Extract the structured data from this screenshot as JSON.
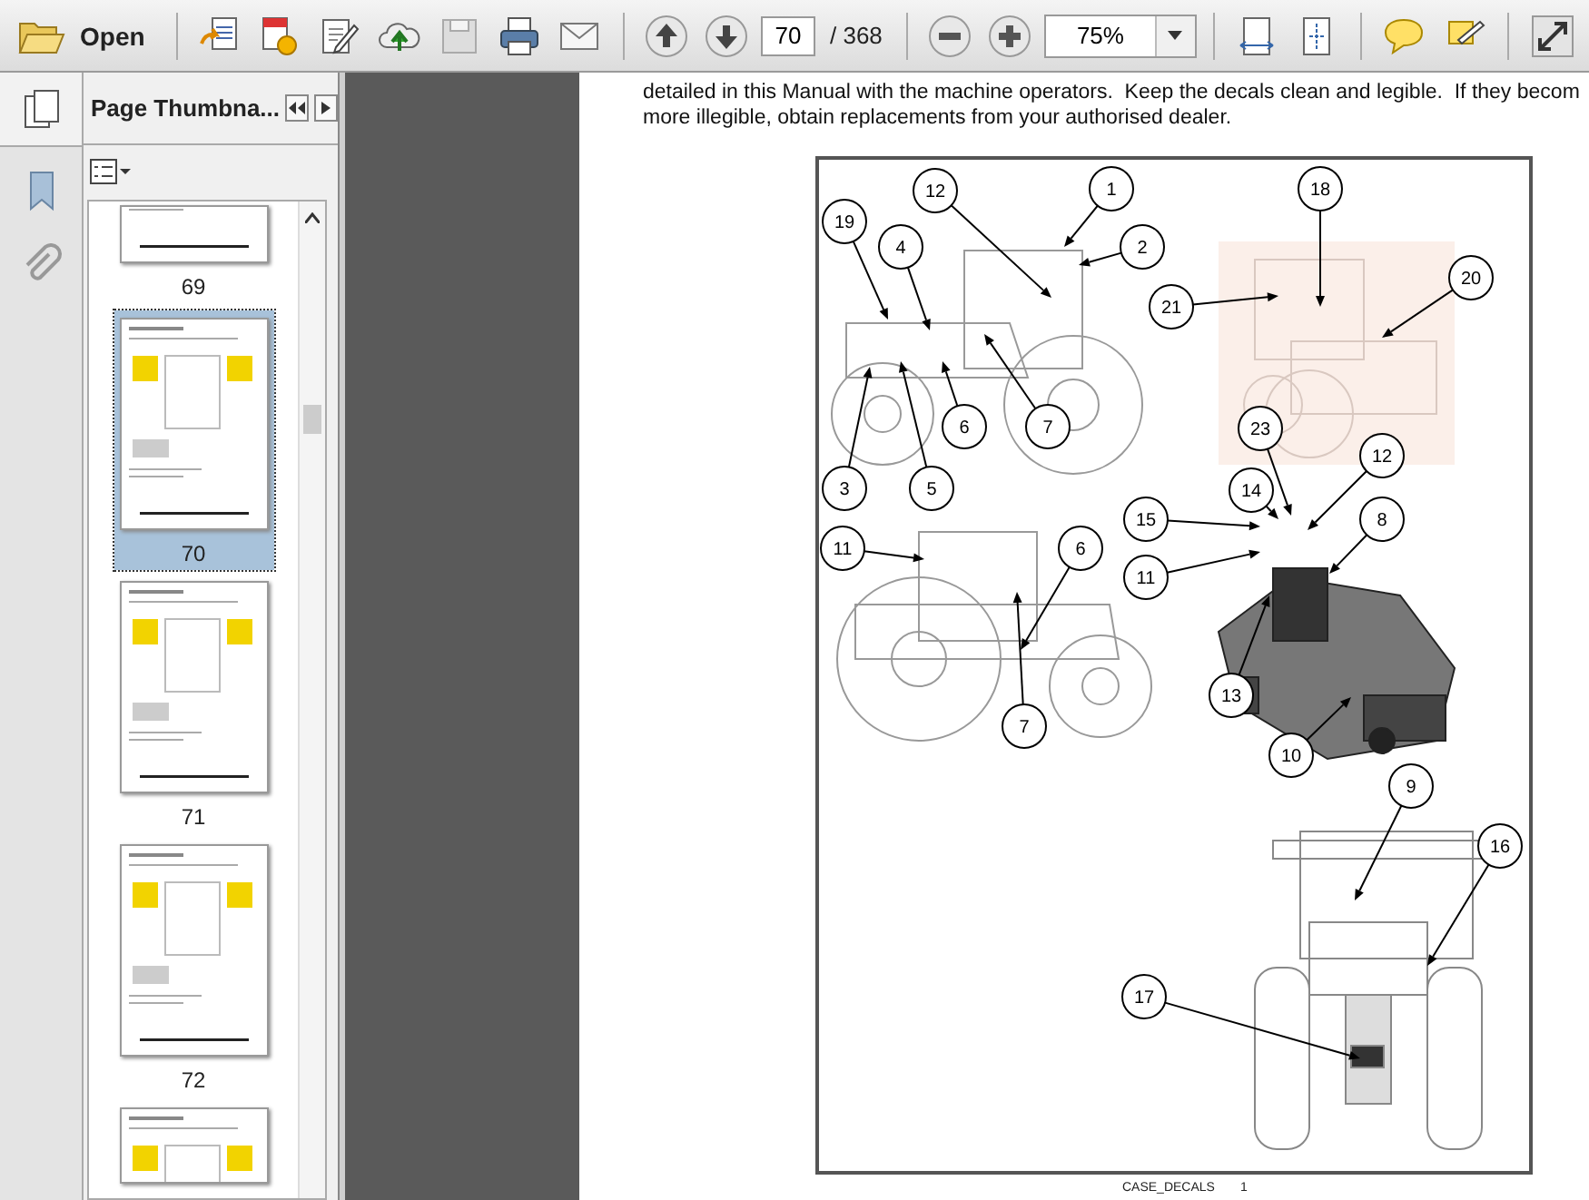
{
  "toolbar": {
    "open_label": "Open",
    "page_number": "70",
    "page_total": "/ 368",
    "zoom": "75%"
  },
  "sidebar": {
    "title": "Page Thumbna...",
    "thumbnails": [
      {
        "label": "69",
        "selected": false
      },
      {
        "label": "70",
        "selected": true
      },
      {
        "label": "71",
        "selected": false
      },
      {
        "label": "72",
        "selected": false
      },
      {
        "selected": false
      }
    ]
  },
  "document": {
    "paragraph_lines": [
      "detailed in this Manual with the machine operators.  Keep the decals clean and legible.  If they becom",
      "more illegible, obtain replacements from your authorised dealer."
    ],
    "figure": {
      "callouts": [
        "12",
        "1",
        "18",
        "19",
        "4",
        "2",
        "20",
        "21",
        "6",
        "7",
        "23",
        "12",
        "3",
        "5",
        "14",
        "15",
        "8",
        "11",
        "6",
        "11",
        "13",
        "7",
        "10",
        "9",
        "16",
        "17"
      ]
    },
    "footer": {
      "name": "CASE_DECALS",
      "page": "1"
    }
  }
}
